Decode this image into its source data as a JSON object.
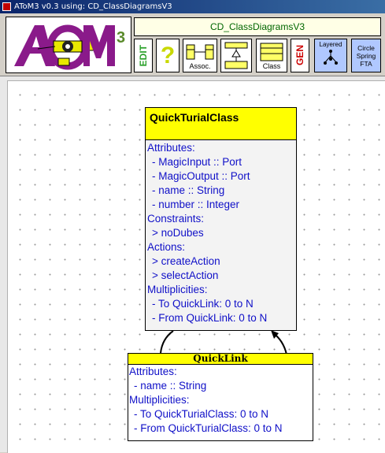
{
  "window": {
    "title": "AToM3 v0.3 using: CD_ClassDiagramsV3"
  },
  "toolbar": {
    "model_name": "CD_ClassDiagramsV3",
    "buttons": {
      "edit": "EDIT",
      "help": "?",
      "assoc": "Assoc.",
      "inherit": "",
      "class": "Class",
      "gen": "GEN",
      "layered": "Layered",
      "spring_1": "Circle",
      "spring_2": "Spring",
      "spring_3": "FTA"
    }
  },
  "class_node": {
    "name": "QuickTurialClass",
    "attributes_header": "Attributes:",
    "attributes": [
      "- MagicInput :: Port",
      "- MagicOutput :: Port",
      "- name :: String",
      "- number :: Integer"
    ],
    "constraints_header": "Constraints:",
    "constraints": [
      "> noDubes"
    ],
    "actions_header": "Actions:",
    "actions": [
      "> createAction",
      "> selectAction"
    ],
    "multiplicities_header": "Multiplicities:",
    "multiplicities": [
      "- To QuickLink: 0 to N",
      "- From QuickLink: 0 to N"
    ]
  },
  "link_node": {
    "name": "QuickLink",
    "attributes_header": "Attributes:",
    "attributes": [
      "- name :: String"
    ],
    "multiplicities_header": "Multiplicities:",
    "multiplicities": [
      "- To QuickTurialClass: 0 to N",
      "- From QuickTurialClass: 0 to N"
    ]
  },
  "colors": {
    "header_yellow": "#ffff00",
    "body_text_blue": "#1010c8",
    "model_name_green": "#006600"
  }
}
